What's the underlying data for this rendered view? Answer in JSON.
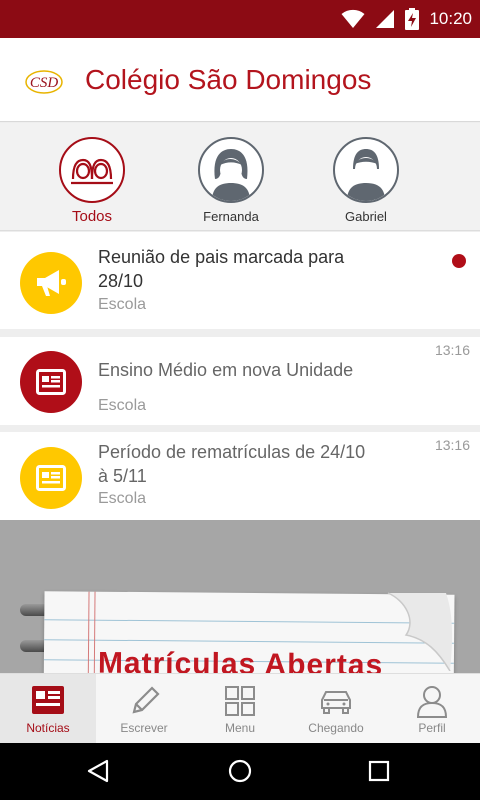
{
  "status_bar": {
    "time": "10:20",
    "icons": [
      "wifi-icon",
      "signal-icon",
      "battery-charging-icon"
    ]
  },
  "header": {
    "logo_text": "CSD",
    "title": "Colégio São Domingos"
  },
  "filters": [
    {
      "label": "Todos",
      "icon": "two-people-icon",
      "active": true
    },
    {
      "label": "Fernanda",
      "icon": "girl-avatar-icon",
      "active": false
    },
    {
      "label": "Gabriel",
      "icon": "boy-avatar-icon",
      "active": false
    }
  ],
  "feed": [
    {
      "title": "Reunião de pais marcada para 28/10",
      "source": "Escola",
      "time": "",
      "unread": true,
      "icon": "megaphone-icon",
      "icon_color": "#ffc800"
    },
    {
      "title": "Ensino Médio em nova Unidade",
      "source": "Escola",
      "time": "13:16",
      "unread": false,
      "icon": "newspaper-icon",
      "icon_color": "#b00e18"
    },
    {
      "title": "Período de rematrículas de 24/10 à 5/11",
      "source": "Escola",
      "time": "13:16",
      "unread": false,
      "icon": "newspaper-icon",
      "icon_color": "#ffc800"
    }
  ],
  "banner": {
    "text": "Matrículas Abertas"
  },
  "bottom_nav": [
    {
      "label": "Notícias",
      "icon": "news-icon",
      "active": true
    },
    {
      "label": "Escrever",
      "icon": "pencil-icon",
      "active": false
    },
    {
      "label": "Menu",
      "icon": "grid-icon",
      "active": false
    },
    {
      "label": "Chegando",
      "icon": "car-icon",
      "active": false
    },
    {
      "label": "Perfil",
      "icon": "person-icon",
      "active": false
    }
  ],
  "colors": {
    "brand": "#b3141d",
    "status_bar": "#8c0b14",
    "accent_yellow": "#ffc800"
  }
}
